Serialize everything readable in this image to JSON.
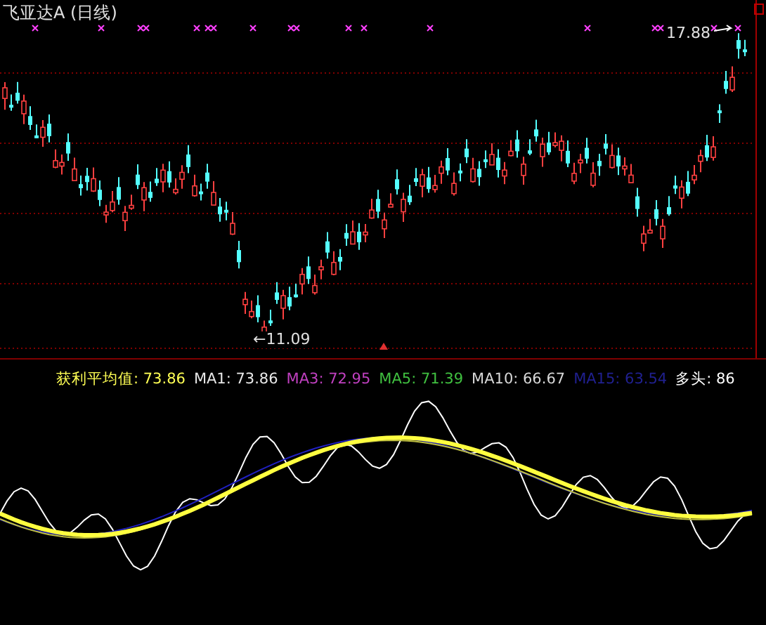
{
  "chart": {
    "title": "飞亚达A (日线)",
    "high_label": "17.88",
    "low_label": "←11.09"
  },
  "indicator": {
    "items": [
      {
        "label": "获利平均值:",
        "value": "73.86",
        "color": "#ffff54"
      },
      {
        "label": "MA1:",
        "value": "73.86",
        "color": "#e8e8e8"
      },
      {
        "label": "MA3:",
        "value": "72.95",
        "color": "#c040c0"
      },
      {
        "label": "MA5:",
        "value": "71.39",
        "color": "#40c040"
      },
      {
        "label": "MA10:",
        "value": "66.67",
        "color": "#d8d8d8"
      },
      {
        "label": "MA15:",
        "value": "63.54",
        "color": "#202090"
      },
      {
        "label": "多头:",
        "value": "86",
        "color": "#ffffff"
      }
    ]
  }
}
